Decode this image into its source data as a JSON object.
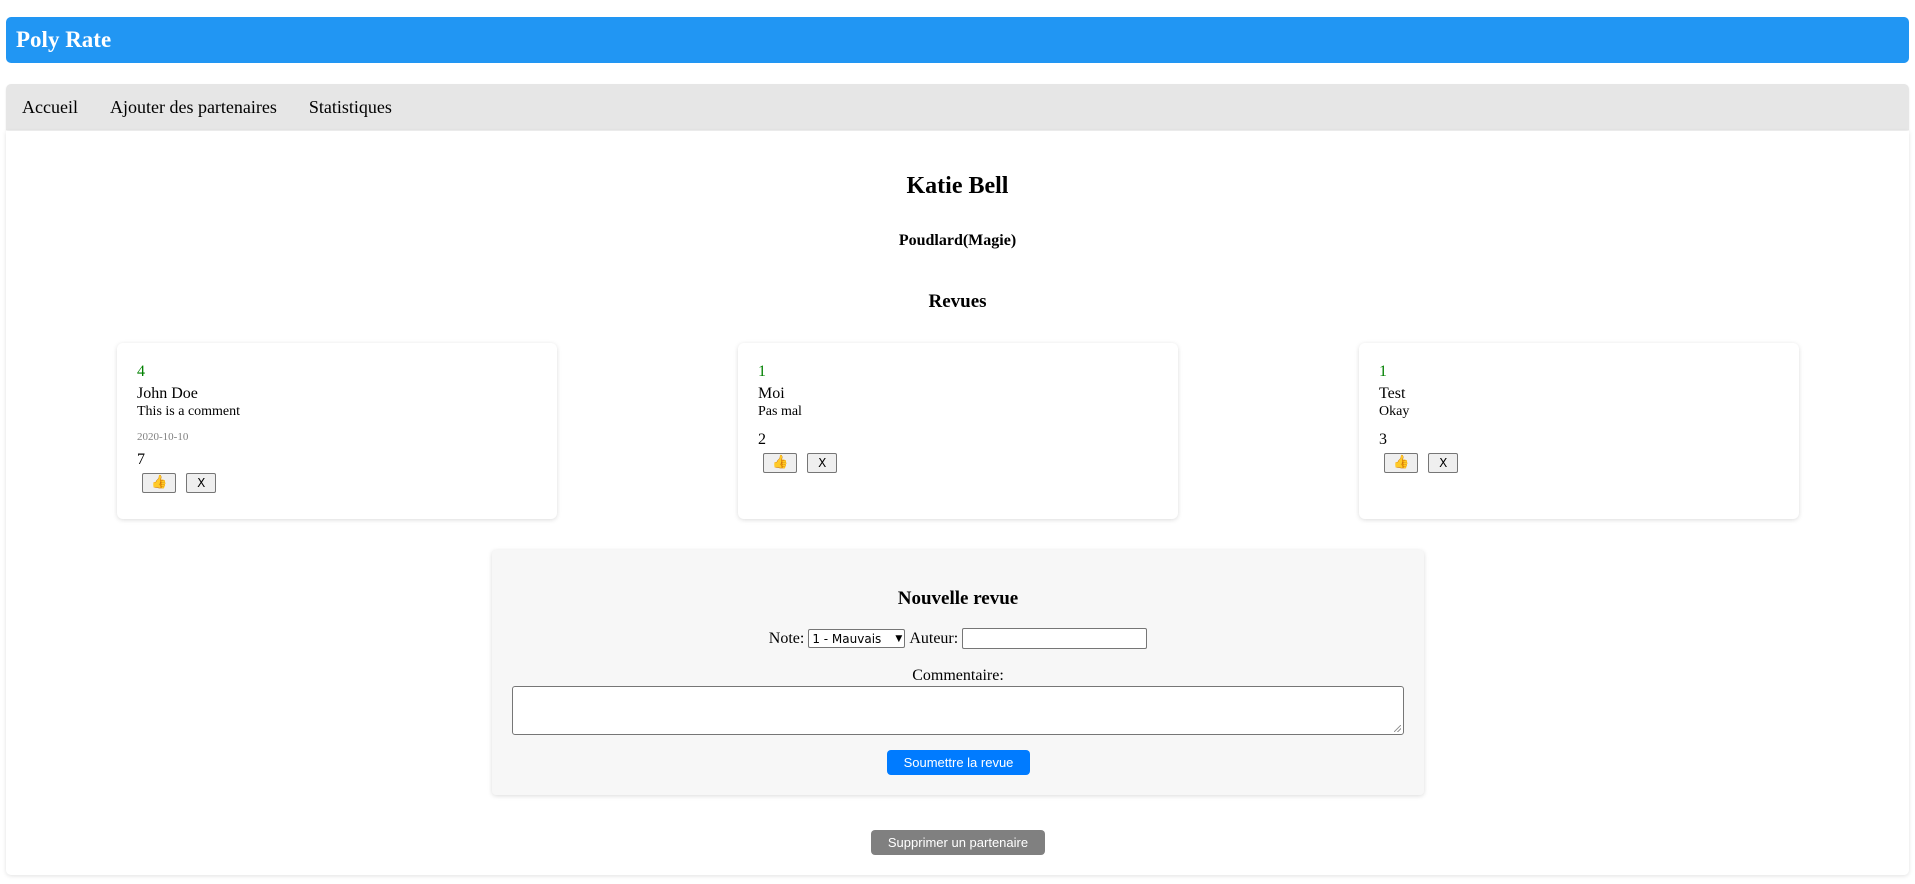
{
  "app": {
    "title": "Poly Rate"
  },
  "nav": {
    "items": [
      {
        "label": "Accueil"
      },
      {
        "label": "Ajouter des partenaires"
      },
      {
        "label": "Statistiques"
      }
    ]
  },
  "partner": {
    "name": "Katie Bell",
    "school": "Poudlard(Magie)"
  },
  "reviews": {
    "heading": "Revues",
    "items": [
      {
        "rating": "4",
        "author": "John Doe",
        "comment": "This is a comment",
        "date": "2020-10-10",
        "likes": "7",
        "like_icon": "👍",
        "delete_label": "X"
      },
      {
        "rating": "1",
        "author": "Moi",
        "comment": "Pas mal",
        "date": "",
        "likes": "2",
        "like_icon": "👍",
        "delete_label": "X"
      },
      {
        "rating": "1",
        "author": "Test",
        "comment": "Okay",
        "date": "",
        "likes": "3",
        "like_icon": "👍",
        "delete_label": "X"
      }
    ]
  },
  "form": {
    "title": "Nouvelle revue",
    "note_label": "Note:",
    "note_selected": "1 - Mauvais",
    "author_label": "Auteur:",
    "author_value": "",
    "comment_label": "Commentaire:",
    "comment_value": "",
    "submit_label": "Soumettre la revue"
  },
  "delete_partner_label": "Supprimer un partenaire",
  "colors": {
    "header_bg": "#2196f3",
    "rating_text": "#008000",
    "submit_bg": "#007bff",
    "delete_bg": "#808080"
  }
}
